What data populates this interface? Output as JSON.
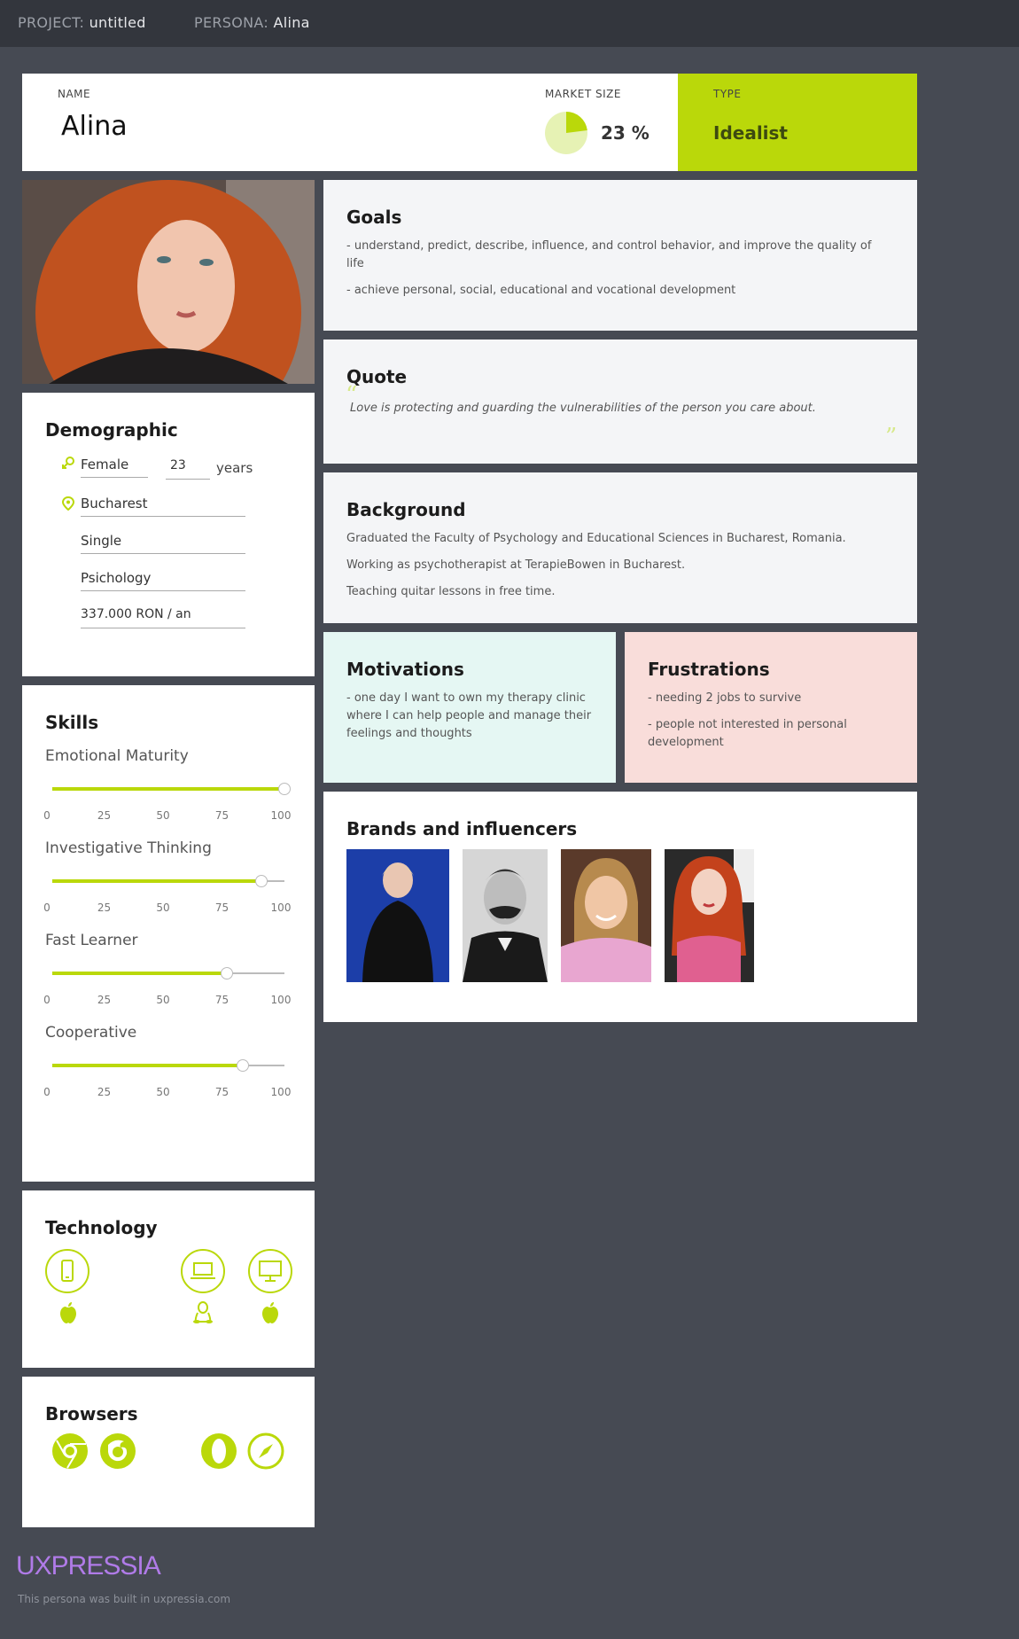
{
  "topbar": {
    "project_label": "PROJECT:",
    "project_value": "untitled",
    "persona_label": "PERSONA:",
    "persona_value": "Alina"
  },
  "header": {
    "name_label": "NAME",
    "name_value": "Alina",
    "market_label": "MARKET SIZE",
    "market_value": "23 %",
    "market_fraction": 0.23,
    "type_label": "TYPE",
    "type_value": "Idealist"
  },
  "colors": {
    "accent": "#bad80a",
    "motivations_bg": "#e5f7f3",
    "frustrations_bg": "#f9ddda",
    "brand": "#b07be8"
  },
  "goals": {
    "title": "Goals",
    "items": [
      "- understand, predict, describe, influence, and control behavior, and improve the quality of life",
      "- achieve personal, social, educational and vocational development"
    ]
  },
  "quote": {
    "title": "Quote",
    "text": "Love is protecting and guarding the vulnerabilities of the person you care about."
  },
  "background": {
    "title": "Background",
    "items": [
      "Graduated the Faculty of Psychology and Educational Sciences in Bucharest, Romania.",
      "Working as psychotherapist at TerapieBowen in Bucharest.",
      "Teaching quitar lessons in free time."
    ]
  },
  "motivations": {
    "title": "Motivations",
    "items": [
      "- one day I want to own my therapy clinic where I can help people and manage their feelings and thoughts"
    ]
  },
  "frustrations": {
    "title": "Frustrations",
    "items": [
      "- needing 2 jobs to survive",
      "- people not interested in personal development"
    ]
  },
  "brands": {
    "title": "Brands and influencers"
  },
  "demographic": {
    "title": "Demographic",
    "gender": "Female",
    "age": "23",
    "age_unit": "years",
    "location": "Bucharest",
    "status": "Single",
    "occupation": "Psichology",
    "income": "337.000 RON / an"
  },
  "skills": {
    "title": "Skills",
    "ticks": [
      "0",
      "25",
      "50",
      "75",
      "100"
    ],
    "items": [
      {
        "label": "Emotional Maturity",
        "value": 100
      },
      {
        "label": "Investigative Thinking",
        "value": 90
      },
      {
        "label": "Fast Learner",
        "value": 75
      },
      {
        "label": "Cooperative",
        "value": 82
      }
    ]
  },
  "technology": {
    "title": "Technology",
    "devices": [
      {
        "icon": "mobile-phone-icon",
        "os": "apple-icon"
      },
      {
        "icon": "laptop-icon",
        "os": "linux-icon"
      },
      {
        "icon": "desktop-icon",
        "os": "apple-icon"
      }
    ]
  },
  "browsers": {
    "title": "Browsers",
    "items": [
      "chrome-icon",
      "firefox-icon",
      "opera-icon",
      "safari-icon"
    ]
  },
  "footer": {
    "brand": "UXPRESSIA",
    "note": "This persona was built in uxpressia.com"
  }
}
